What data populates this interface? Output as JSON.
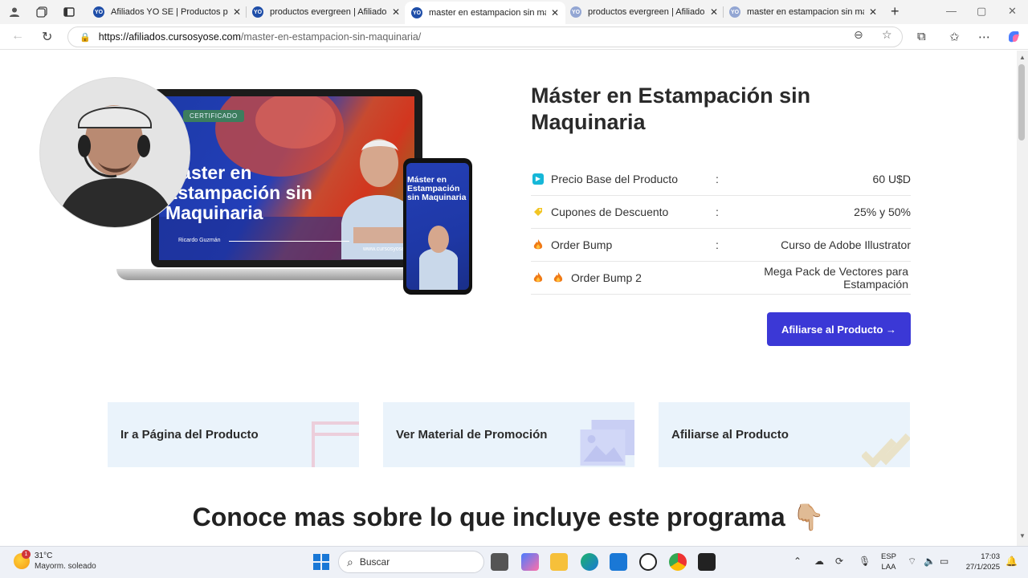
{
  "browser": {
    "tabs": [
      {
        "title": "Afiliados YO SE | Productos para a"
      },
      {
        "title": "productos evergreen | Afiliados Y"
      },
      {
        "title": "master en estampacion sin maqu"
      },
      {
        "title": "productos evergreen | Afiliados Y"
      },
      {
        "title": "master en estampacion sin maqu"
      }
    ],
    "url_host": "https://afiliados.cursosyose.com",
    "url_path": "/master-en-estampacion-sin-maquinaria/"
  },
  "mockup": {
    "badge": "CERTIFICADO",
    "title": "Máster en Estampación sin Maquinaria",
    "phone_title": "Máster en Estampación sin Maquinaria",
    "author": "Ricardo Guzmán",
    "web": "www.cursosyose"
  },
  "product": {
    "title": "Máster en Estampación sin Maquinaria",
    "rows": [
      {
        "label": "Precio Base del Producto",
        "colon": ":",
        "value": "60 U$D"
      },
      {
        "label": "Cupones de Descuento",
        "colon": ":",
        "value": "25% y 50%"
      },
      {
        "label": "Order Bump",
        "colon": ":",
        "value": "Curso de Adobe Illustrator"
      },
      {
        "label": "Order Bump 2",
        "colon": "",
        "value": "Mega Pack de Vectores para Estampación"
      }
    ],
    "cta": "Afiliarse al Producto →"
  },
  "cards": [
    {
      "label": "Ir a Página del Producto"
    },
    {
      "label": "Ver Material de Promoción"
    },
    {
      "label": "Afiliarse al Producto"
    }
  ],
  "section": {
    "title": "Conoce mas sobre lo que incluye este programa 👇🏼"
  },
  "taskbar": {
    "weather_temp": "31°C",
    "weather_desc": "Mayorm. soleado",
    "weather_badge": "1",
    "search_placeholder": "Buscar",
    "lang_1": "ESP",
    "lang_2": "LAA",
    "time": "17:03",
    "date": "27/1/2025"
  },
  "colors": {
    "accent": "#3b38d6",
    "card_bg": "#eaf3fb",
    "title": "#2a2a2a"
  }
}
